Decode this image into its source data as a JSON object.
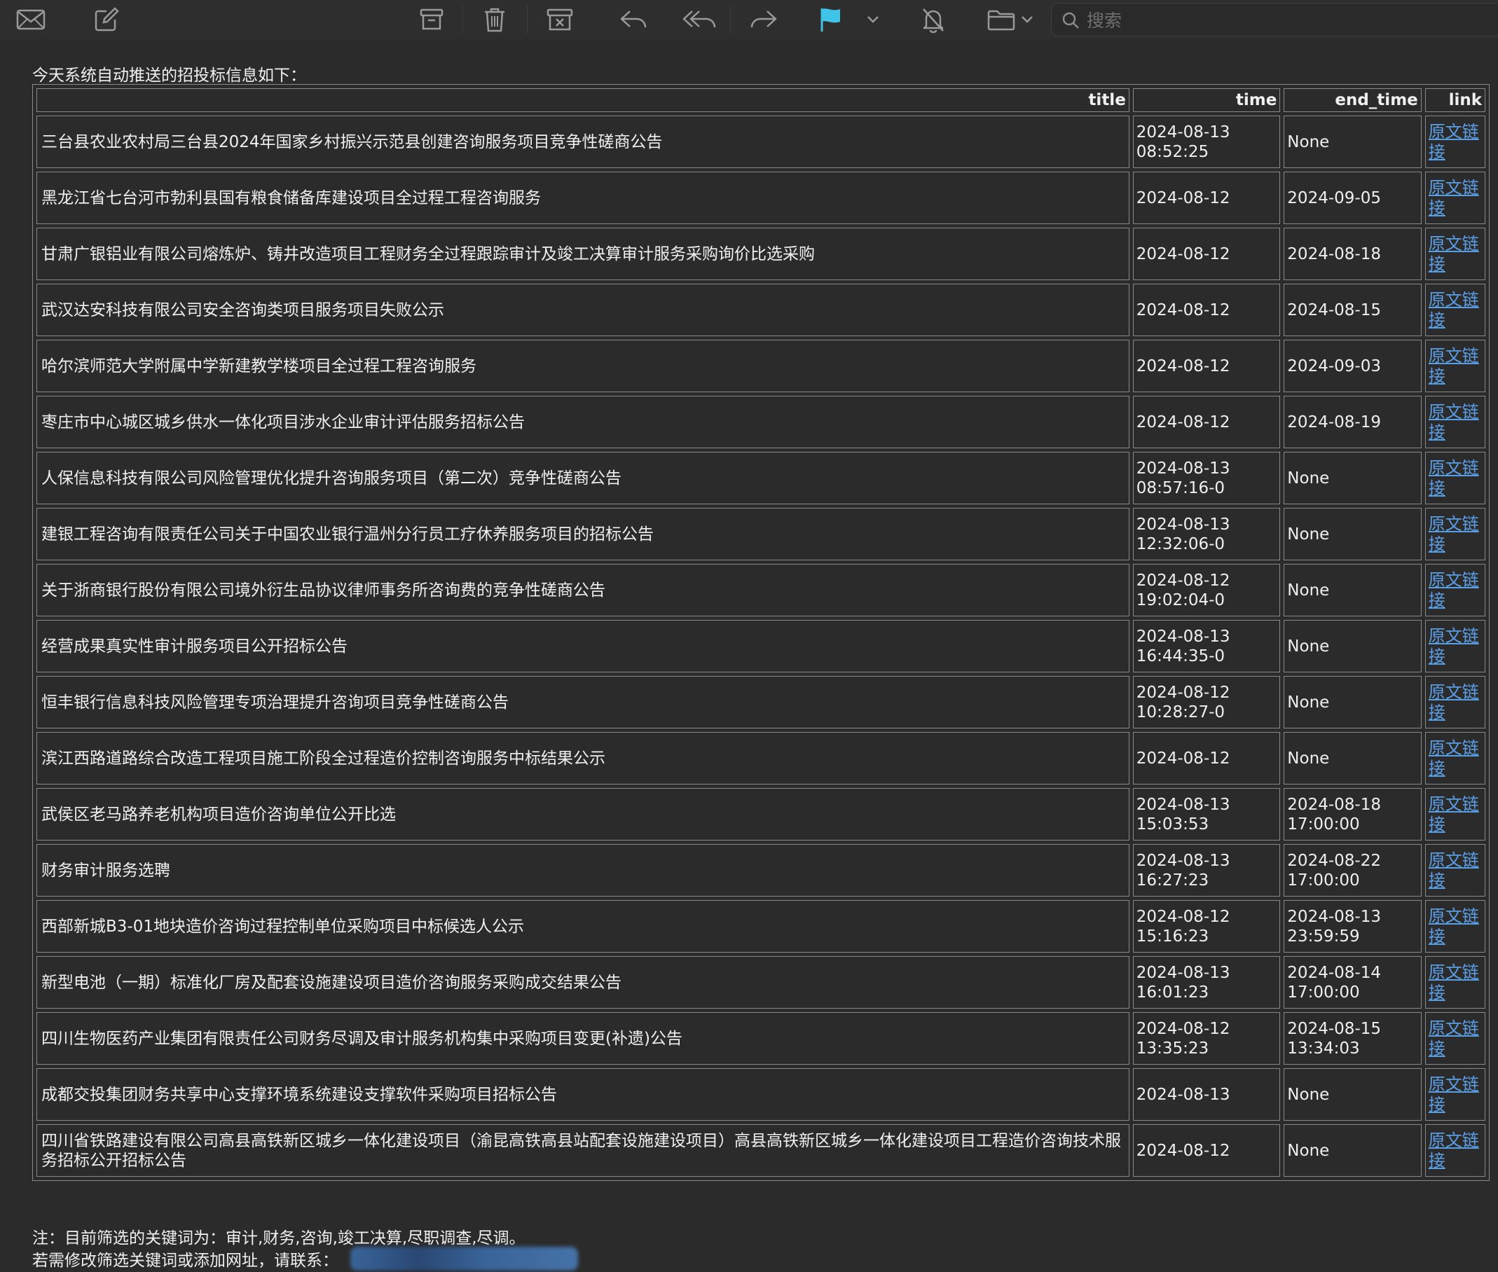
{
  "toolbar": {
    "icons": [
      "envelope-icon",
      "compose-icon",
      "archive-icon",
      "trash-icon",
      "junk-icon",
      "reply-icon",
      "reply-all-icon",
      "forward-icon",
      "flag-icon",
      "chevron-down-icon",
      "mute-bell-icon",
      "folder-icon",
      "search-icon"
    ],
    "flag_color": "#3fc3e8",
    "search_placeholder": "搜索"
  },
  "email": {
    "intro": "今天系统自动推送的招投标信息如下：",
    "headers": {
      "title": "title",
      "time": "time",
      "end_time": "end_time",
      "link": "link"
    },
    "rows": [
      {
        "title": "三台县农业农村局三台县2024年国家乡村振兴示范县创建咨询服务项目竞争性磋商公告",
        "time": "2024-08-13\n08:52:25",
        "end_time": "None",
        "link": "原文链接"
      },
      {
        "title": "黑龙江省七台河市勃利县国有粮食储备库建设项目全过程工程咨询服务",
        "time": "2024-08-12",
        "end_time": "2024-09-05",
        "link": "原文链接"
      },
      {
        "title": "甘肃广银铝业有限公司熔炼炉、铸井改造项目工程财务全过程跟踪审计及竣工决算审计服务采购询价比选采购",
        "time": "2024-08-12",
        "end_time": "2024-08-18",
        "link": "原文链接"
      },
      {
        "title": "武汉达安科技有限公司安全咨询类项目服务项目失败公示",
        "time": "2024-08-12",
        "end_time": "2024-08-15",
        "link": "原文链接"
      },
      {
        "title": "哈尔滨师范大学附属中学新建教学楼项目全过程工程咨询服务",
        "time": "2024-08-12",
        "end_time": "2024-09-03",
        "link": "原文链接"
      },
      {
        "title": "枣庄市中心城区城乡供水一体化项目涉水企业审计评估服务招标公告",
        "time": "2024-08-12",
        "end_time": "2024-08-19",
        "link": "原文链接"
      },
      {
        "title": "人保信息科技有限公司风险管理优化提升咨询服务项目（第二次）竞争性磋商公告",
        "time": "2024-08-13\n08:57:16-0",
        "end_time": "None",
        "link": "原文链接"
      },
      {
        "title": "建银工程咨询有限责任公司关于中国农业银行温州分行员工疗休养服务项目的招标公告",
        "time": "2024-08-13\n12:32:06-0",
        "end_time": "None",
        "link": "原文链接"
      },
      {
        "title": "关于浙商银行股份有限公司境外衍生品协议律师事务所咨询费的竞争性磋商公告",
        "time": "2024-08-12\n19:02:04-0",
        "end_time": "None",
        "link": "原文链接"
      },
      {
        "title": "经营成果真实性审计服务项目公开招标公告",
        "time": "2024-08-13\n16:44:35-0",
        "end_time": "None",
        "link": "原文链接"
      },
      {
        "title": "恒丰银行信息科技风险管理专项治理提升咨询项目竞争性磋商公告",
        "time": "2024-08-12\n10:28:27-0",
        "end_time": "None",
        "link": "原文链接"
      },
      {
        "title": "滨江西路道路综合改造工程项目施工阶段全过程造价控制咨询服务中标结果公示",
        "time": "2024-08-12",
        "end_time": "None",
        "link": "原文链接"
      },
      {
        "title": "武侯区老马路养老机构项目造价咨询单位公开比选",
        "time": "2024-08-13\n15:03:53",
        "end_time": "2024-08-18\n17:00:00",
        "link": "原文链接"
      },
      {
        "title": "财务审计服务选聘",
        "time": "2024-08-13\n16:27:23",
        "end_time": "2024-08-22\n17:00:00",
        "link": "原文链接"
      },
      {
        "title": "西部新城B3-01地块造价咨询过程控制单位采购项目中标候选人公示",
        "time": "2024-08-12\n15:16:23",
        "end_time": "2024-08-13\n23:59:59",
        "link": "原文链接"
      },
      {
        "title": "新型电池（一期）标准化厂房及配套设施建设项目造价咨询服务采购成交结果公告",
        "time": "2024-08-13\n16:01:23",
        "end_time": "2024-08-14\n17:00:00",
        "link": "原文链接"
      },
      {
        "title": "四川生物医药产业集团有限责任公司财务尽调及审计服务机构集中采购项目变更(补遗)公告",
        "time": "2024-08-12\n13:35:23",
        "end_time": "2024-08-15\n13:34:03",
        "link": "原文链接"
      },
      {
        "title": "成都交投集团财务共享中心支撑环境系统建设支撑软件采购项目招标公告",
        "time": "2024-08-13",
        "end_time": "None",
        "link": "原文链接"
      },
      {
        "title": "四川省铁路建设有限公司高县高铁新区城乡一体化建设项目（渝昆高铁高县站配套设施建设项目）高县高铁新区城乡一体化建设项目工程造价咨询技术服务招标公开招标公告",
        "time": "2024-08-12",
        "end_time": "None",
        "link": "原文链接"
      }
    ],
    "note_keywords": "注：目前筛选的关键词为：审计,财务,咨询,竣工决算,尽职调查,尽调。",
    "note_contact": "若需修改筛选关键词或添加网址，请联系："
  }
}
